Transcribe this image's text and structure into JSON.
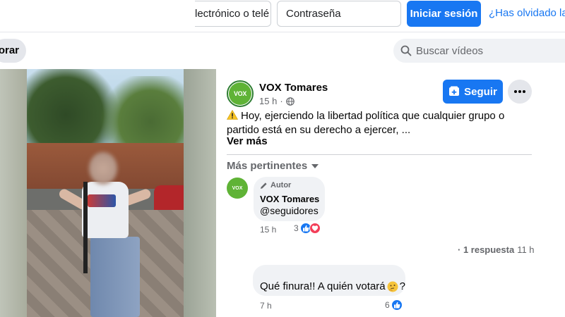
{
  "login": {
    "email_placeholder": "lectrónico o telé",
    "password_placeholder": "Contraseña",
    "login_button": "Iniciar sesión",
    "forgot_link": "¿Has olvidado la"
  },
  "nav": {
    "explore_label": "orar",
    "search_placeholder": "Buscar vídeos"
  },
  "post": {
    "page_name": "VOX Tomares",
    "avatar_text": "VOX",
    "time": "15 h",
    "time_separator": "·",
    "privacy_icon": "globe-icon",
    "follow_label": "Seguir",
    "text": "Hoy, ejerciendo la libertad política que cualquier grupo o partido está en su derecho a ejercer, ...",
    "see_more": "Ver más",
    "sort_label": "Más pertinentes"
  },
  "comments": [
    {
      "avatar_text": "VOX",
      "author_tag": "Autor",
      "name": "VOX Tomares",
      "text": "@seguidores",
      "time": "15 h",
      "reaction_count": "3"
    },
    {
      "text": "Qué finura!! A quién votará",
      "text_suffix": "?",
      "time": "7 h",
      "reaction_count": "6"
    }
  ],
  "replies": {
    "label": "· 1 respuesta",
    "time": "11 h"
  },
  "colors": {
    "accent": "#1877f2",
    "vox_green": "#5fb336",
    "love": "#f33e58"
  }
}
